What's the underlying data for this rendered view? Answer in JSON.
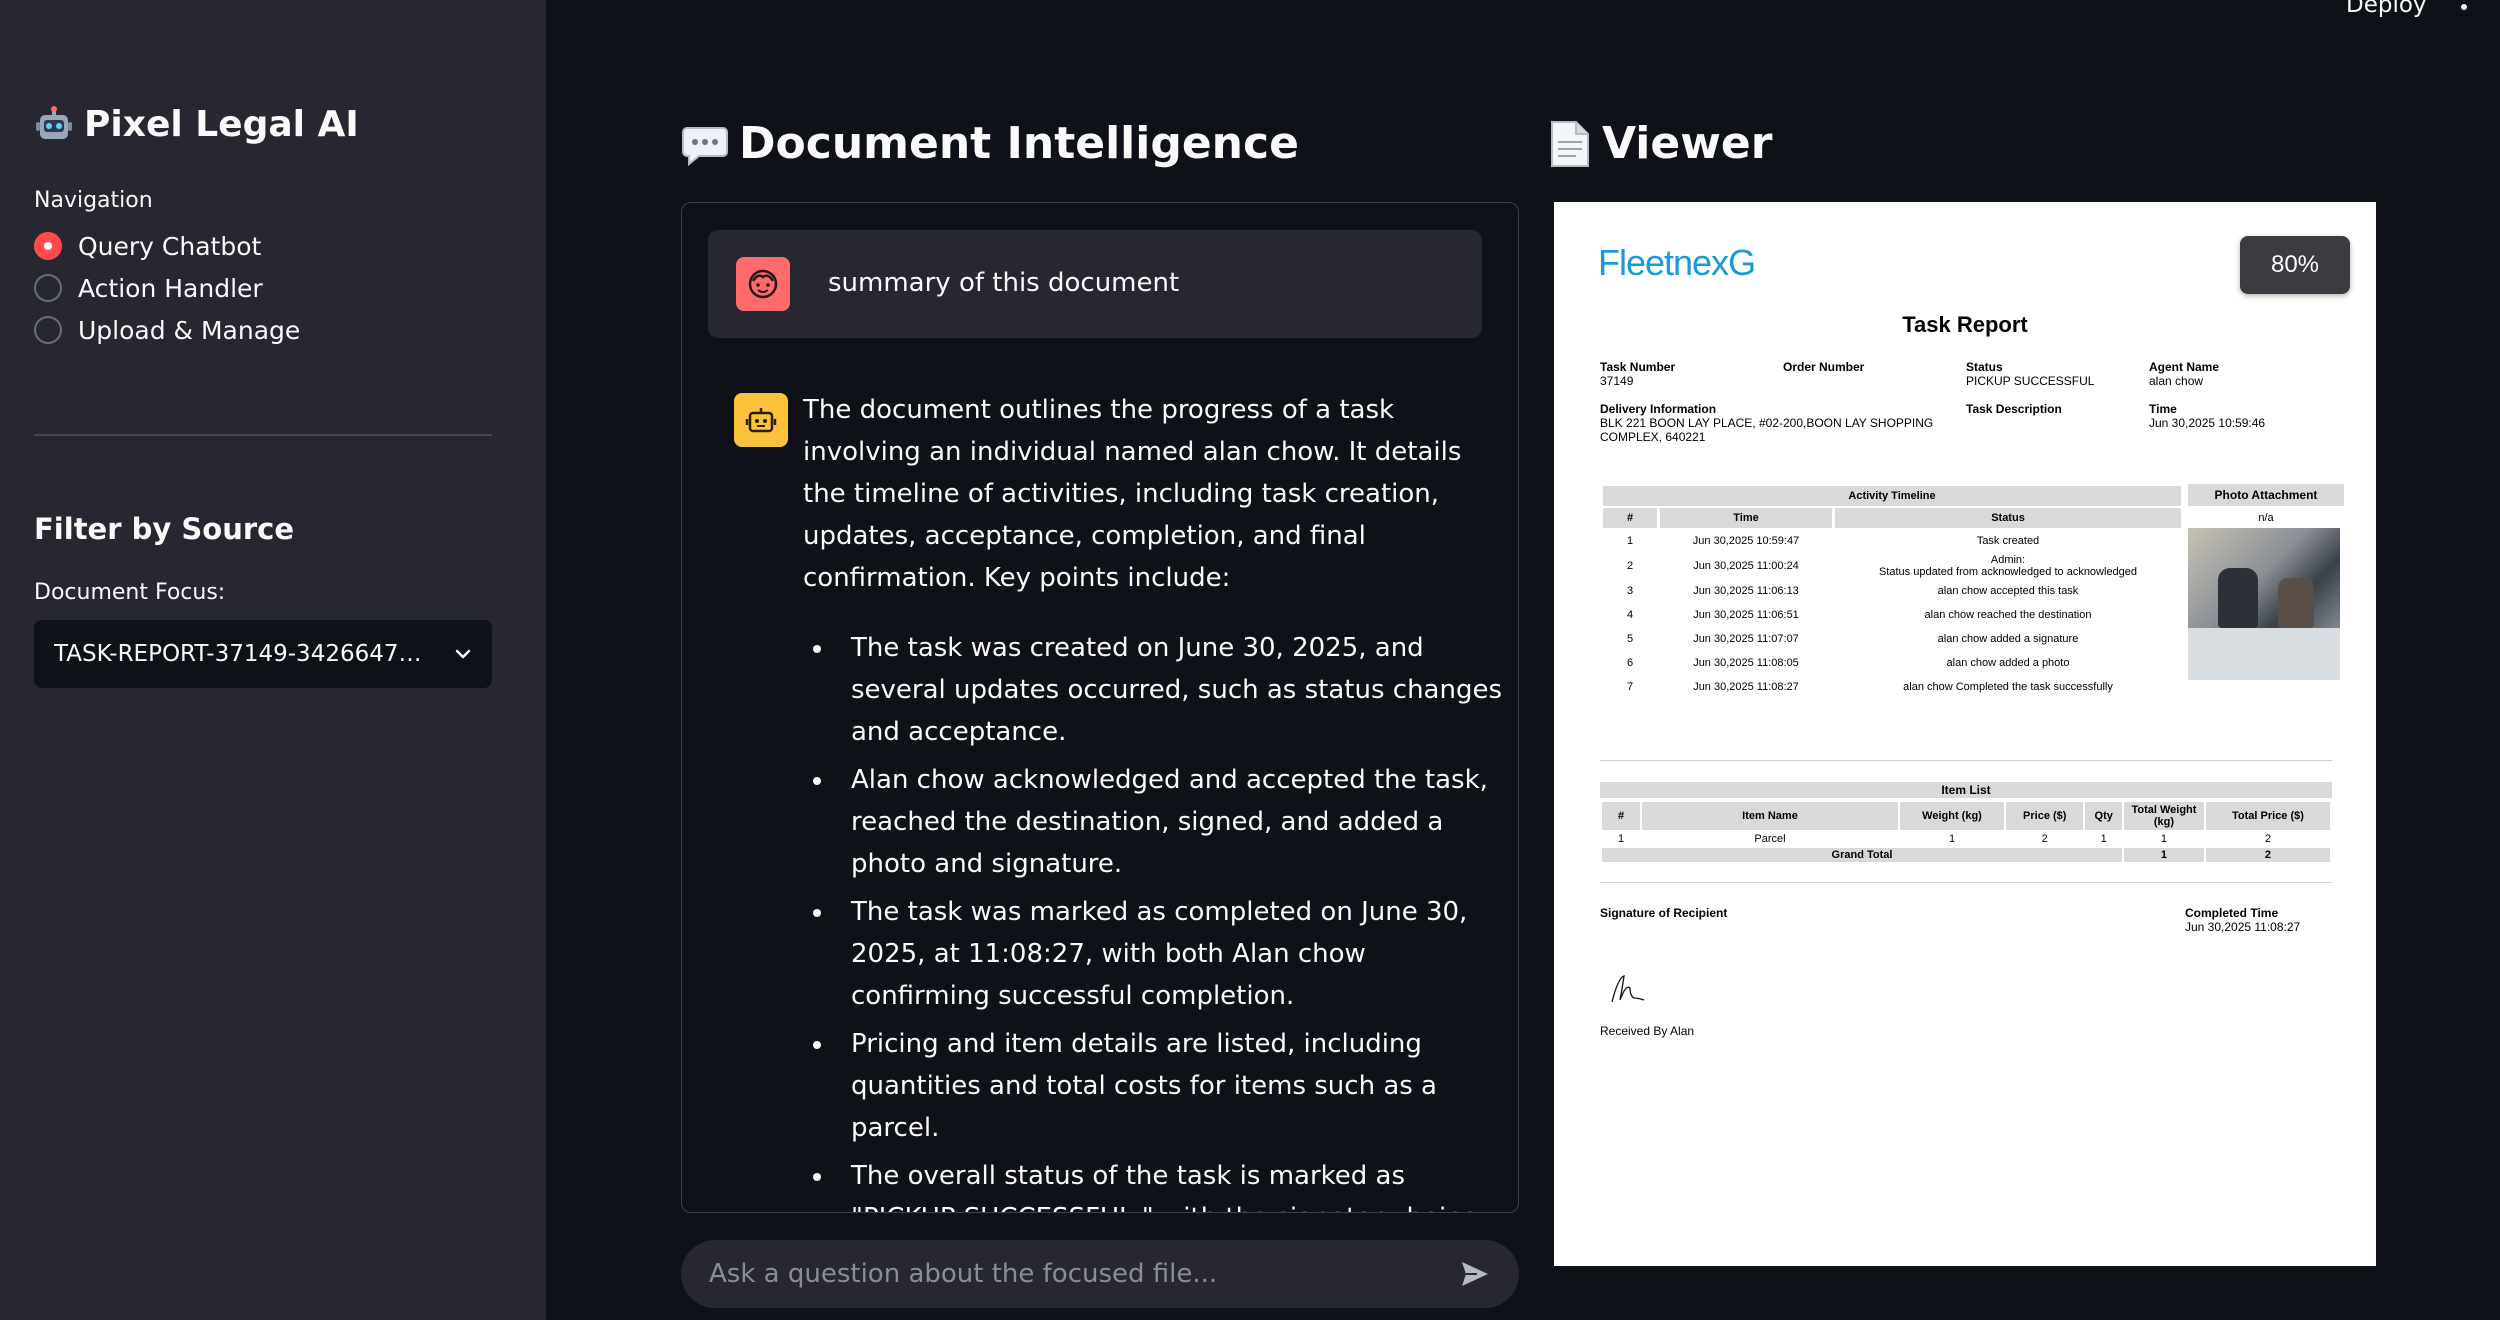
{
  "sidebar": {
    "app_title": "Pixel Legal AI",
    "nav_label": "Navigation",
    "nav_items": [
      {
        "label": "Query Chatbot",
        "selected": true
      },
      {
        "label": "Action Handler",
        "selected": false
      },
      {
        "label": "Upload & Manage",
        "selected": false
      }
    ],
    "filter_title": "Filter by Source",
    "doc_focus_label": "Document Focus:",
    "doc_focus_value": "TASK-REPORT-37149-3426647…"
  },
  "topbar": {
    "deploy_label": "Deploy"
  },
  "chat": {
    "header": "Document Intelligence",
    "user_message": "summary of this document",
    "bot_intro": "The document outlines the progress of a task involving an individual named alan chow. It details the timeline of activities, including task creation, updates, acceptance, completion, and final confirmation. Key points include:",
    "bot_points": [
      "The task was created on June 30, 2025, and several updates occurred, such as status changes and acceptance.",
      "Alan chow acknowledged and accepted the task, reached the destination, signed, and added a photo and signature.",
      "The task was marked as completed on June 30, 2025, at 11:08:27, with both Alan chow confirming successful completion.",
      "Pricing and item details are listed, including quantities and total costs for items such as a parcel.",
      "The overall status of the task is marked as \"PICKUP SUCCESSFUL,\" with the signatory being \"Received By Alan.\""
    ],
    "input_placeholder": "Ask a question about the focused file..."
  },
  "viewer": {
    "header": "Viewer",
    "zoom": "80%",
    "logo_text": "FleetnexG",
    "report_title": "Task Report",
    "meta_row1": [
      {
        "label": "Task Number",
        "value": "37149"
      },
      {
        "label": "Order Number",
        "value": ""
      },
      {
        "label": "Status",
        "value": "PICKUP SUCCESSFUL"
      },
      {
        "label": "Agent Name",
        "value": "alan chow"
      }
    ],
    "delivery_label": "Delivery Information",
    "delivery_value": "BLK 221 BOON LAY PLACE, #02-200,BOON LAY SHOPPING COMPLEX, 640221",
    "task_desc_label": "Task Description",
    "time_label": "Time",
    "time_value": "Jun 30,2025 10:59:46",
    "timeline_title": "Activity Timeline",
    "timeline_headers": [
      "#",
      "Time",
      "Status"
    ],
    "timeline_rows": [
      {
        "n": "1",
        "time": "Jun 30,2025 10:59:47",
        "status": "Task created",
        "status2": ""
      },
      {
        "n": "2",
        "time": "Jun 30,2025 11:00:24",
        "status": "Admin:",
        "status2": "Status updated from acknowledged to acknowledged"
      },
      {
        "n": "3",
        "time": "Jun 30,2025 11:06:13",
        "status": "alan chow accepted this task",
        "status2": ""
      },
      {
        "n": "4",
        "time": "Jun 30,2025 11:06:51",
        "status": "alan chow reached the destination",
        "status2": ""
      },
      {
        "n": "5",
        "time": "Jun 30,2025 11:07:07",
        "status": "alan chow added a signature",
        "status2": ""
      },
      {
        "n": "6",
        "time": "Jun 30,2025 11:08:05",
        "status": "alan chow added a photo",
        "status2": ""
      },
      {
        "n": "7",
        "time": "Jun 30,2025 11:08:27",
        "status": "alan chow Completed the task successfully",
        "status2": ""
      }
    ],
    "photo_title": "Photo Attachment",
    "photo_na": "n/a",
    "items_title": "Item List",
    "items_headers": [
      "#",
      "Item Name",
      "Weight (kg)",
      "Price ($)",
      "Qty",
      "Total Weight (kg)",
      "Total Price ($)"
    ],
    "items_rows": [
      [
        "1",
        "Parcel",
        "1",
        "2",
        "1",
        "1",
        "2"
      ]
    ],
    "grand_total_label": "Grand Total",
    "grand_total_weight": "1",
    "grand_total_price": "2",
    "signature_label": "Signature of Recipient",
    "completed_label": "Completed Time",
    "completed_value": "Jun 30,2025 11:08:27",
    "received_by": "Received By Alan"
  },
  "colors": {
    "accent": "#ff4b4b",
    "sidebar_bg": "#262730",
    "main_bg": "#0e1117",
    "bot_avatar": "#fcc23b",
    "user_avatar": "#ff6b6b"
  }
}
